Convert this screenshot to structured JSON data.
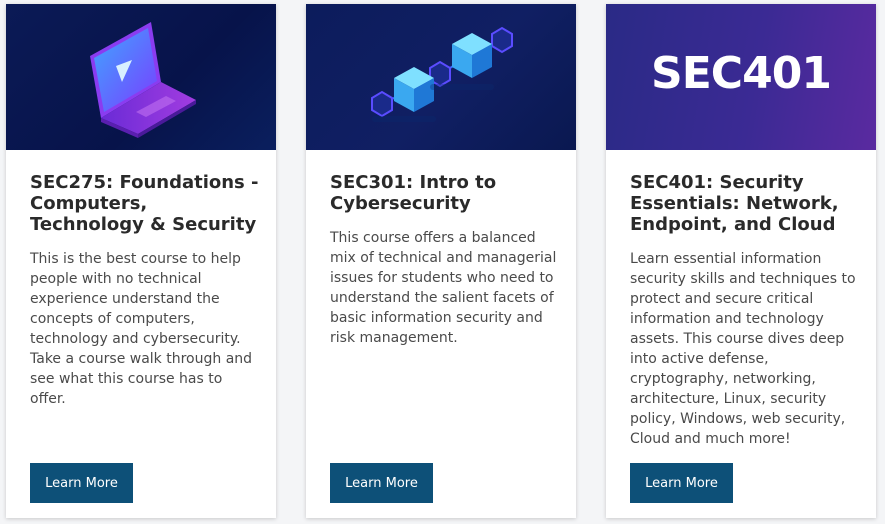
{
  "courses": [
    {
      "banner_icon": "laptop-icon",
      "title": "SEC275: Foundations - Computers, Technology & Security",
      "description": "This is the best course to help people with no technical experience understand the concepts of computers, technology and cybersecurity. Take a course walk through and see what this course has to offer.",
      "button_label": "Learn More"
    },
    {
      "banner_icon": "blockchain-cubes-icon",
      "title": "SEC301: Intro to Cybersecurity",
      "description": "This course offers a balanced mix of technical and managerial issues for students who need to understand the salient facets of basic information security and risk management.",
      "button_label": "Learn More"
    },
    {
      "banner_text": "SEC401",
      "title": "SEC401: Security Essentials: Network, Endpoint, and Cloud",
      "description": "Learn essential information security skills and techniques to protect and secure critical information and technology assets. This course dives deep into active defense, cryptography, networking, architecture, Linux, security policy, Windows, web security, Cloud  and much more!",
      "button_label": "Learn More"
    }
  ],
  "colors": {
    "button": "#0d5078",
    "title_text": "#2a2a2a",
    "body_text": "#4a4a4a"
  }
}
